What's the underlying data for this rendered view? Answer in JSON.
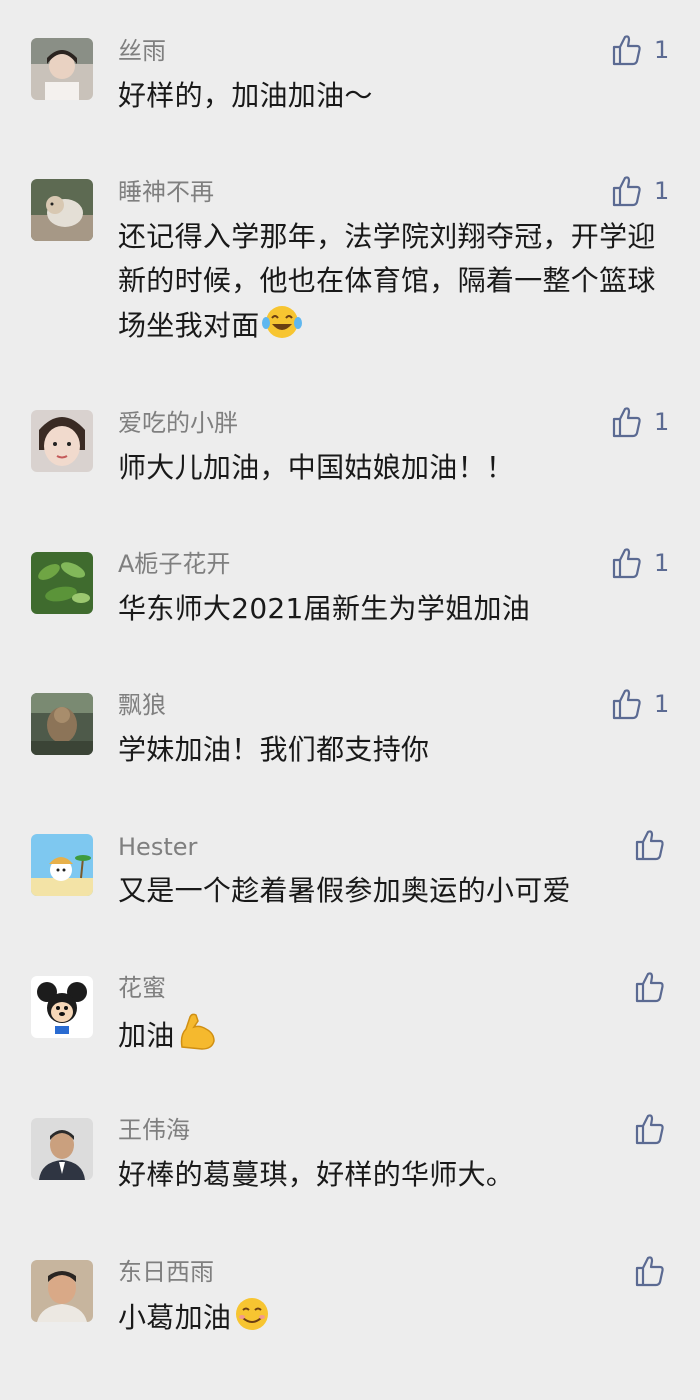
{
  "comments": [
    {
      "name": "丝雨",
      "text": "好样的，加油加油～",
      "likes": "1"
    },
    {
      "name": "睡神不再",
      "text": "还记得入学那年，法学院刘翔夺冠，开学迎新的时候，他也在体育馆，隔着一整个篮球场坐我对面",
      "likes": "1"
    },
    {
      "name": "爱吃的小胖",
      "text": "师大儿加油，中国姑娘加油！！",
      "likes": "1"
    },
    {
      "name": "A栀子花开",
      "text": "华东师大2021届新生为学姐加油",
      "likes": "1"
    },
    {
      "name": "飘狼",
      "text": "学妹加油！我们都支持你",
      "likes": "1"
    },
    {
      "name": "Hester",
      "text": "又是一个趁着暑假参加奥运的小可爱",
      "likes": ""
    },
    {
      "name": "花蜜",
      "text": "加油",
      "likes": ""
    },
    {
      "name": "王伟海",
      "text": "好棒的葛蔓琪，好样的华师大。",
      "likes": ""
    },
    {
      "name": "东日西雨",
      "text": "小葛加油",
      "likes": ""
    }
  ],
  "colors": {
    "background": "#ededed",
    "name": "#7f7f7f",
    "text": "#191919",
    "like": "#5b6a92"
  },
  "icons": {
    "like": "thumbs-up-icon",
    "emoji_laugh": "tears-of-joy-emoji",
    "emoji_muscle": "flexed-biceps-emoji",
    "emoji_smile": "smiling-face-emoji"
  }
}
